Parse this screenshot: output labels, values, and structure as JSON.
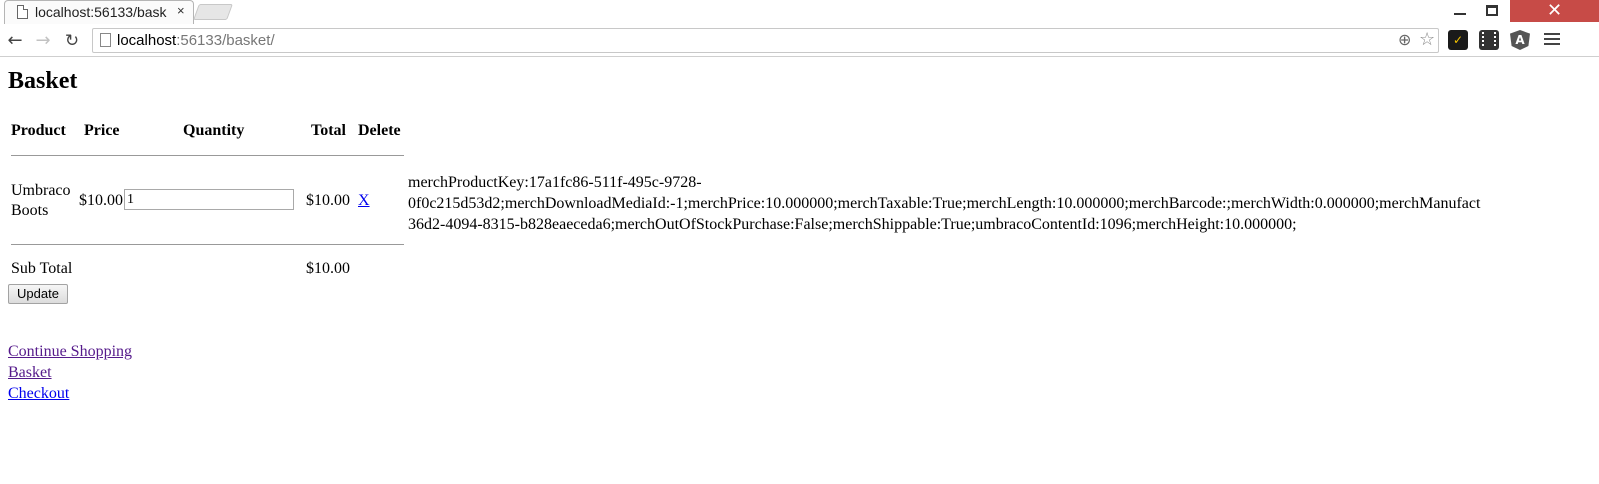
{
  "browser": {
    "tab_title": "localhost:56133/bask",
    "tab_close": "×",
    "url_host": "localhost",
    "url_rest": ":56133/basket/",
    "window_close": "✕"
  },
  "page": {
    "heading": "Basket",
    "table": {
      "headers": {
        "product": "Product",
        "price": "Price",
        "quantity": "Quantity",
        "total": "Total",
        "delete": "Delete"
      },
      "row": {
        "product_line1": "Umbraco",
        "product_line2": "Boots",
        "price": "$10.00",
        "quantity": "1",
        "total": "$10.00",
        "delete": "X",
        "meta_line1": "merchProductKey:17a1fc86-511f-495c-9728-",
        "meta_line2": "0f0c215d53d2;merchDownloadMediaId:-1;merchPrice:10.000000;merchTaxable:True;merchLength:10.000000;merchBarcode:;merchWidth:0.000000;merchManufact",
        "meta_line3": "36d2-4094-8315-b828eaeceda6;merchOutOfStockPurchase:False;merchShippable:True;umbracoContentId:1096;merchHeight:10.000000;"
      },
      "subtotal_label": "Sub Total",
      "subtotal_value": "$10.00"
    },
    "update_button": "Update",
    "links": {
      "continue_shopping": "Continue Shopping",
      "basket": "Basket",
      "checkout": "Checkout"
    }
  }
}
